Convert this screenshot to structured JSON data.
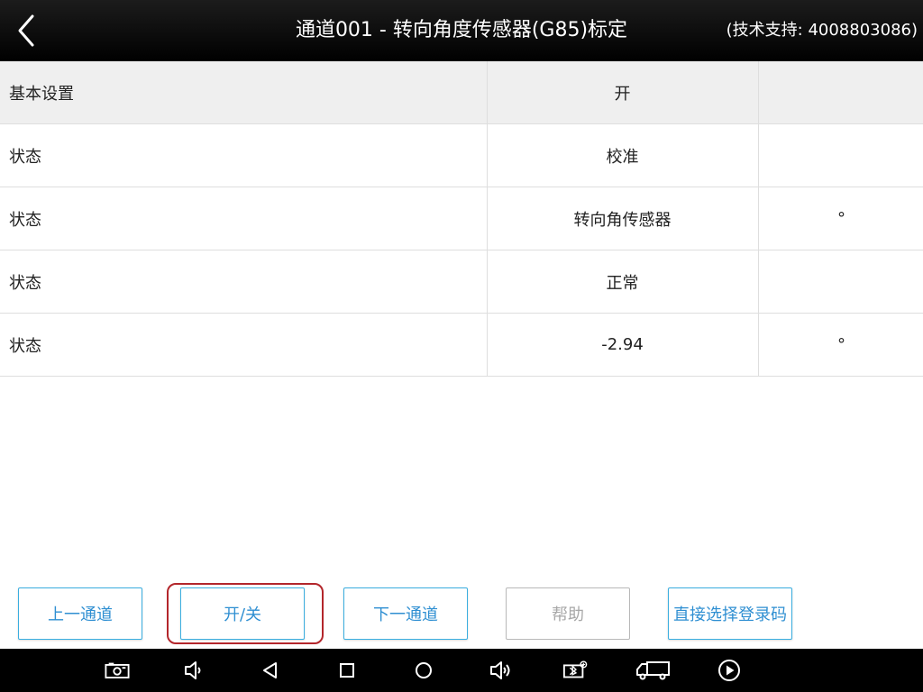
{
  "header": {
    "title": "通道001 - 转向角度传感器(G85)标定",
    "support": "(技术支持: 4008803086)"
  },
  "table": {
    "rows": [
      {
        "label": "基本设置",
        "value": "开",
        "unit": ""
      },
      {
        "label": "状态",
        "value": "校准",
        "unit": ""
      },
      {
        "label": "状态",
        "value": "转向角传感器",
        "unit": "°"
      },
      {
        "label": "状态",
        "value": "正常",
        "unit": ""
      },
      {
        "label": "状态",
        "value": "-2.94",
        "unit": "°"
      }
    ]
  },
  "buttons": {
    "prev_channel": "上一通道",
    "toggle": "开/关",
    "next_channel": "下一通道",
    "help": "帮助",
    "direct_login": "直接选择登录码"
  },
  "colors": {
    "accent": "#2f8fd2",
    "button_border": "#3aaee0",
    "highlight": "#b3262b",
    "header_bg": "#000000"
  },
  "navbar_icons": [
    "screenshot-icon",
    "volume-down-icon",
    "back-icon",
    "recents-icon",
    "home-icon",
    "volume-up-icon",
    "vci-connection-icon",
    "truck-icon",
    "play-icon"
  ]
}
